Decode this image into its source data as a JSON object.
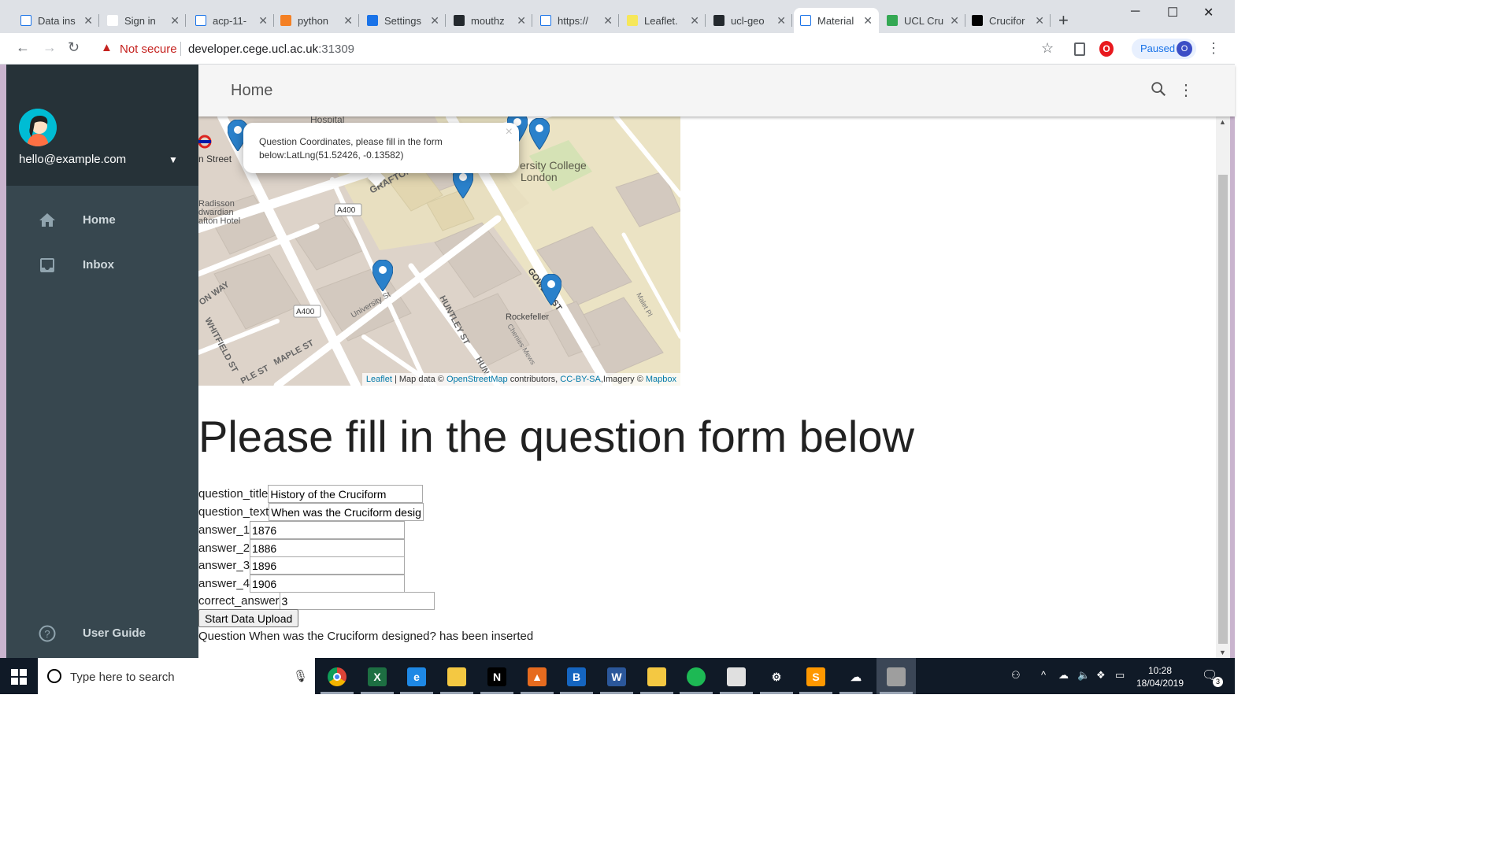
{
  "browser": {
    "tabs": [
      {
        "label": "Data ins",
        "icon": "document-icon"
      },
      {
        "label": "Sign in",
        "icon": "google-icon"
      },
      {
        "label": "acp-11-",
        "icon": "document-icon"
      },
      {
        "label": "python",
        "icon": "stackoverflow-icon"
      },
      {
        "label": "Settings",
        "icon": "gear-icon"
      },
      {
        "label": "mouthz",
        "icon": "github-icon"
      },
      {
        "label": "https://",
        "icon": "document-icon"
      },
      {
        "label": "Leaflet.",
        "icon": "leaflet-icon"
      },
      {
        "label": "ucl-geo",
        "icon": "github-icon"
      },
      {
        "label": "Material",
        "icon": "document-icon",
        "active": true
      },
      {
        "label": "UCL Cru",
        "icon": "maps-icon"
      },
      {
        "label": "Crucifor",
        "icon": "ucl-icon"
      }
    ],
    "security_label": "Not secure",
    "url_host": "developer.cege.ucl.ac.uk",
    "url_port": ":31309",
    "profile_label": "Paused",
    "profile_initial": "O"
  },
  "sidebar": {
    "user_email": "hello@example.com",
    "items": [
      {
        "label": "Home",
        "icon": "home-icon"
      },
      {
        "label": "Inbox",
        "icon": "inbox-icon"
      },
      {
        "label": "User Guide",
        "icon": "help-icon"
      }
    ]
  },
  "appbar": {
    "title": "Home"
  },
  "map": {
    "popup_text": "Question Coordinates, please fill in the form below:LatLng(51.52426, -0.13582)",
    "labels": {
      "hospital": "Hospital",
      "street": "n Street",
      "grafton": "GRAFTON",
      "ucl_1": "ersity College",
      "ucl_2": "London",
      "a400_1": "A400",
      "a400_2": "A400",
      "radisson_1": "Radisson",
      "radisson_2": "dwardian",
      "radisson_3": "afton Hotel",
      "on_way": "ON WAY",
      "whitfield": "WHITFIELD ST",
      "maple": "MAPLE ST",
      "ple_st": "PLE ST",
      "university": "University St",
      "huntley": "HUNTLEY ST",
      "hun": "HUN",
      "gower": "GOWER",
      "st": "ST",
      "rockefeller": "Rockefeller",
      "chenies": "Chenies Mews",
      "malet": "Malet Pl"
    },
    "attribution": {
      "leaflet": "Leaflet",
      "mapdata": "| Map data ©",
      "osm": "OpenStreetMap",
      "contributors": "contributors,",
      "license": "CC-BY-SA",
      "imagery": ",Imagery ©",
      "mapbox": "Mapbox"
    }
  },
  "form": {
    "heading": "Please fill in the question form below",
    "fields": [
      {
        "label": "question_title",
        "value": "History of the Cruciform"
      },
      {
        "label": "question_text",
        "value": "When was the Cruciform designed?"
      },
      {
        "label": "answer_1",
        "value": "1876"
      },
      {
        "label": "answer_2",
        "value": "1886"
      },
      {
        "label": "answer_3",
        "value": "1896"
      },
      {
        "label": "answer_4",
        "value": "1906"
      },
      {
        "label": "correct_answer",
        "value": "3"
      }
    ],
    "submit_label": "Start Data Upload",
    "status": "Question When was the Cruciform designed? has been inserted"
  },
  "taskbar": {
    "search_placeholder": "Type here to search",
    "time": "10:28",
    "date": "18/04/2019",
    "notification_count": "3",
    "apps": [
      {
        "name": "chrome-icon",
        "glyph": "",
        "color": "#db4437"
      },
      {
        "name": "excel-icon",
        "glyph": "X",
        "color": "#1d6f42"
      },
      {
        "name": "edge-icon",
        "glyph": "e",
        "color": "#1e88e5"
      },
      {
        "name": "file-explorer-icon",
        "glyph": "",
        "color": "#f4c842"
      },
      {
        "name": "netflix-icon",
        "glyph": "N",
        "color": "#000000"
      },
      {
        "name": "matlab-icon",
        "glyph": "▲",
        "color": "#e66b1f"
      },
      {
        "name": "b-app-icon",
        "glyph": "B",
        "color": "#1565c0"
      },
      {
        "name": "word-icon",
        "glyph": "W",
        "color": "#2b579a"
      },
      {
        "name": "file-manager-icon",
        "glyph": "",
        "color": "#f4c842"
      },
      {
        "name": "spotify-icon",
        "glyph": "",
        "color": "#1db954"
      },
      {
        "name": "paint-icon",
        "glyph": "",
        "color": "#e0e0e0"
      },
      {
        "name": "settings-icon",
        "glyph": "⚙",
        "color": "#101a27"
      },
      {
        "name": "sublime-icon",
        "glyph": "S",
        "color": "#ff9800"
      },
      {
        "name": "cloud-app-icon",
        "glyph": "☁",
        "color": "#101a27"
      },
      {
        "name": "qgis-icon",
        "glyph": "",
        "color": "#9e9e9e"
      }
    ]
  }
}
